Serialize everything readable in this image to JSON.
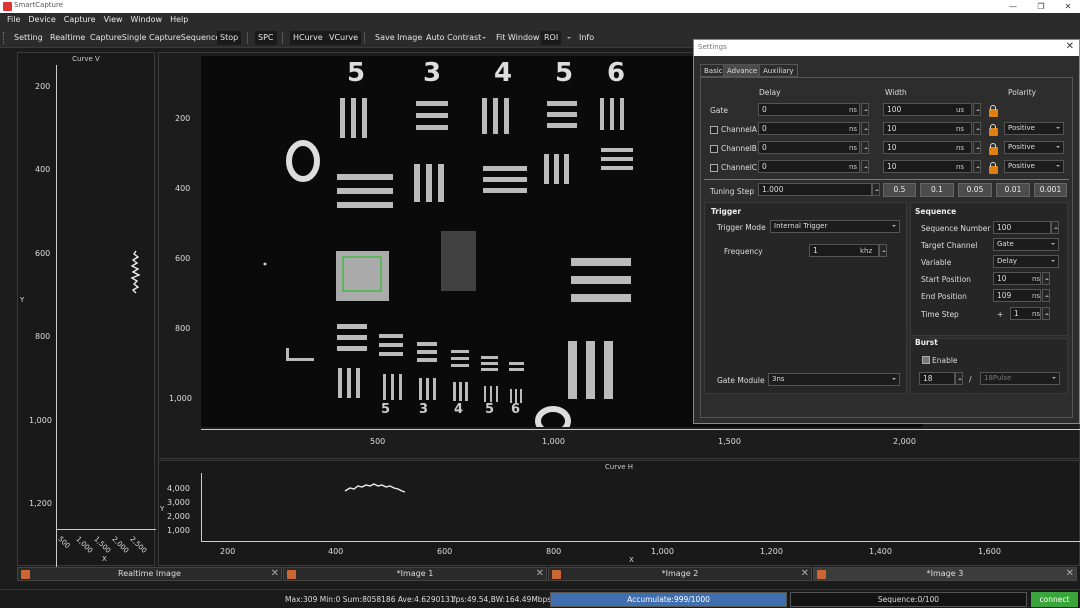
{
  "app": {
    "title": "SmartCapture"
  },
  "menu": [
    "File",
    "Device",
    "Capture",
    "View",
    "Window",
    "Help"
  ],
  "toolbar": {
    "setting": "Setting",
    "realtime": "Realtime",
    "capture_single": "CaptureSingle",
    "capture_sequence": "CaptureSequence",
    "stop": "Stop",
    "spc": "SPC",
    "hcurve": "HCurve",
    "vcurve": "VCurve",
    "save_image": "Save Image",
    "auto_contrast": "Auto Contrast",
    "fit_window": "Fit Window",
    "roi": "ROI",
    "info": "Info"
  },
  "curve_v": {
    "title": "Curve V",
    "yticks": [
      "200",
      "400",
      "600",
      "800",
      "1,000",
      "1,200"
    ],
    "xticks": [
      "500",
      "1,000",
      "1,500",
      "2,000",
      "2,500"
    ],
    "xlabel": "X",
    "ylabel": "Y"
  },
  "image_view": {
    "yticks": [
      "200",
      "400",
      "600",
      "800",
      "1,000"
    ],
    "xticks": [
      "500",
      "1,000",
      "1,500",
      "2,000"
    ],
    "target_digits": [
      "5",
      "3",
      "4",
      "5",
      "6"
    ],
    "bottom_digits": [
      "5",
      "3",
      "4",
      "5",
      "6"
    ]
  },
  "curve_h": {
    "title": "Curve H",
    "yticks": [
      "4,000",
      "3,000",
      "2,000",
      "1,000"
    ],
    "xticks": [
      "200",
      "400",
      "600",
      "800",
      "1,000",
      "1,200",
      "1,400",
      "1,600"
    ],
    "xlabel": "X",
    "ylabel": "Y"
  },
  "tabs": [
    "Realtime Image",
    "*Image 1",
    "*Image 2",
    "*Image 3"
  ],
  "status": {
    "stats": "Max:309 Min:0 Sum:8058186 Ave:4.6290131",
    "fps": "fps:49.54,BW:164.49Mbps",
    "accumulate": "Accumulate:999/1000",
    "sequence": "Sequence:0/100",
    "connect": "connect",
    "accumulate_progress": 0.999
  },
  "settings": {
    "title": "Settings",
    "tabs": [
      "Basic",
      "Advance",
      "Auxiliary"
    ],
    "headers": {
      "delay": "Delay",
      "width": "Width",
      "polarity": "Polarity"
    },
    "unit_ns": "ns",
    "rows": [
      {
        "label": "Gate",
        "delay": "0",
        "delay_unit": "ns",
        "width": "100",
        "width_unit": "us",
        "polarity": ""
      },
      {
        "label": "ChannelA",
        "delay": "0",
        "delay_unit": "ns",
        "width": "10",
        "width_unit": "ns",
        "polarity": "Positive"
      },
      {
        "label": "ChannelB",
        "delay": "0",
        "delay_unit": "ns",
        "width": "10",
        "width_unit": "ns",
        "polarity": "Positive"
      },
      {
        "label": "ChannelC",
        "delay": "0",
        "delay_unit": "ns",
        "width": "10",
        "width_unit": "ns",
        "polarity": "Positive"
      }
    ],
    "tuning_step": {
      "label": "Tuning Step",
      "value": "1.000",
      "buttons": [
        "0.5",
        "0.1",
        "0.05",
        "0.01",
        "0.001"
      ]
    },
    "trigger": {
      "header": "Trigger",
      "mode_label": "Trigger Mode",
      "mode_value": "Internal Trigger",
      "freq_label": "Frequency",
      "freq_value": "1",
      "freq_unit": "khz",
      "gate_module_label": "Gate Module",
      "gate_module_value": "3ns"
    },
    "sequence": {
      "header": "Sequence",
      "number_label": "Sequence Number",
      "number_value": "100",
      "target_label": "Target Channel",
      "target_value": "Gate",
      "variable_label": "Variable",
      "variable_value": "Delay",
      "start_label": "Start Position",
      "start_value": "10",
      "start_unit": "ns",
      "end_label": "End Position",
      "end_value": "109",
      "end_unit": "ns",
      "step_label": "Time Step",
      "step_sign": "+",
      "step_value": "1",
      "step_unit": "ns"
    },
    "burst": {
      "header": "Burst",
      "enable_label": "Enable",
      "enabled": true,
      "count": "18",
      "slash": "/",
      "pulse": "18Pulse"
    }
  }
}
